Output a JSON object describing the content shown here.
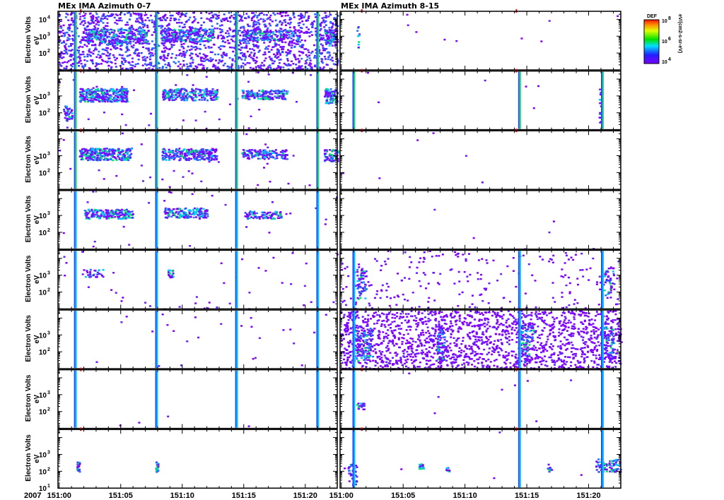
{
  "chart_data": {
    "type": "heatmap",
    "titles": {
      "left": "MEx IMA Azimuth 0-7",
      "right": "MEx IMA Azimuth 8-15"
    },
    "year": "2007",
    "x_ticks": [
      "151:00",
      "151:05",
      "151:10",
      "151:15",
      "151:20"
    ],
    "x_tick_minutes": [
      0,
      5,
      10,
      15,
      20
    ],
    "x_range_minutes": [
      -0.1,
      22.6
    ],
    "ylabel": "Electron Volts",
    "yunit": "eV",
    "y_range": [
      10,
      30000
    ],
    "colorbar": {
      "label": "DEF",
      "ticks": [
        "8",
        "6",
        "4"
      ],
      "tick_base": "10",
      "unit": "eV/(cm2-s-sr-eV)"
    },
    "spikes_left": [
      1.2,
      7.8,
      14.3,
      20.9
    ],
    "spikes_right": [
      0.9,
      14.3,
      21.0
    ],
    "markers_left": [
      1.7
    ],
    "markers_right": [
      1.6,
      14.1
    ],
    "rows": [
      {
        "y_ticks": [
          4,
          3,
          2
        ],
        "left": {
          "bg": 1800,
          "spikes": true,
          "clusters": [
            [
              2,
              7,
              400,
              3000,
              260
            ],
            [
              8.2,
              12.5,
              500,
              3000,
              200
            ],
            [
              14.8,
              19.5,
              600,
              2500,
              150
            ],
            [
              21.5,
              22.6,
              300,
              3000,
              60
            ]
          ]
        },
        "right": {
          "bg": 10,
          "spikes": false,
          "clusters": [
            [
              1.2,
              1.4,
              200,
              4000,
              10
            ]
          ]
        }
      },
      {
        "y_ticks": [
          3,
          2
        ],
        "left": {
          "bg": 40,
          "spikes": true,
          "clusters": [
            [
              1.6,
              5.5,
              500,
              3000,
              280
            ],
            [
              8.3,
              12.8,
              600,
              3000,
              220
            ],
            [
              14.8,
              18.5,
              700,
              2500,
              160
            ],
            [
              21.5,
              22.6,
              400,
              3000,
              80
            ],
            [
              0.3,
              1.0,
              30,
              300,
              40
            ]
          ]
        },
        "right": {
          "bg": 8,
          "spikes": true,
          "clusters": [
            [
              20.8,
              21.0,
              30,
              3000,
              15
            ]
          ]
        }
      },
      {
        "y_ticks": [
          3,
          2
        ],
        "left": {
          "bg": 40,
          "spikes": true,
          "clusters": [
            [
              1.6,
              5.8,
              600,
              3000,
              260
            ],
            [
              8.3,
              12.8,
              600,
              3000,
              240
            ],
            [
              14.8,
              18.5,
              700,
              2500,
              150
            ],
            [
              21.5,
              22.6,
              500,
              2500,
              70
            ]
          ]
        },
        "right": {
          "bg": 6,
          "spikes": false,
          "clusters": []
        }
      },
      {
        "y_ticks": [
          3,
          2
        ],
        "left": {
          "bg": 30,
          "spikes": true,
          "clusters": [
            [
              2,
              6,
              700,
              2500,
              180
            ],
            [
              8.5,
              12,
              800,
              3000,
              150
            ],
            [
              15,
              18,
              700,
              2000,
              90
            ]
          ]
        },
        "right": {
          "bg": 6,
          "spikes": false,
          "clusters": []
        }
      },
      {
        "y_ticks": [
          3,
          2
        ],
        "left": {
          "bg": 40,
          "spikes": true,
          "clusters": [
            [
              1.8,
              3.5,
              800,
              2500,
              30
            ],
            [
              8.8,
              9.2,
              800,
              2500,
              20
            ]
          ]
        },
        "right": {
          "bg": 220,
          "spikes": true,
          "clusters": [
            [
              1.2,
              2.0,
              40,
              3000,
              60
            ],
            [
              21.2,
              22,
              50,
              3000,
              40
            ]
          ]
        }
      },
      {
        "y_ticks": [
          3,
          2
        ],
        "left": {
          "bg": 25,
          "spikes": true,
          "clusters": []
        },
        "right": {
          "bg": 1700,
          "spikes": true,
          "clusters": [
            [
              1.0,
              2.5,
              30,
              4000,
              120
            ],
            [
              7.7,
              8.3,
              30,
              4000,
              80
            ],
            [
              14.4,
              15.5,
              30,
              4000,
              80
            ],
            [
              21.2,
              22.0,
              30,
              4000,
              60
            ]
          ]
        }
      },
      {
        "y_ticks": [
          3,
          2
        ],
        "left": {
          "bg": 4,
          "spikes": true,
          "clusters": []
        },
        "right": {
          "bg": 8,
          "spikes": true,
          "clusters": [
            [
              1.2,
              1.8,
              150,
              400,
              20
            ]
          ]
        }
      },
      {
        "y_ticks": [
          3,
          2,
          1
        ],
        "left": {
          "bg": 0,
          "spikes": false,
          "clusters": [
            [
              1.4,
              1.6,
              100,
              400,
              20
            ],
            [
              7.8,
              8.0,
              100,
              400,
              20
            ]
          ]
        },
        "right": {
          "bg": 6,
          "spikes": true,
          "clusters": [
            [
              0.5,
              1.2,
              15,
              300,
              40
            ],
            [
              6.2,
              6.6,
              150,
              300,
              15
            ],
            [
              8.4,
              8.7,
              100,
              200,
              10
            ],
            [
              16.5,
              17,
              100,
              300,
              10
            ],
            [
              20.5,
              22.6,
              100,
              600,
              70
            ]
          ]
        }
      }
    ]
  }
}
